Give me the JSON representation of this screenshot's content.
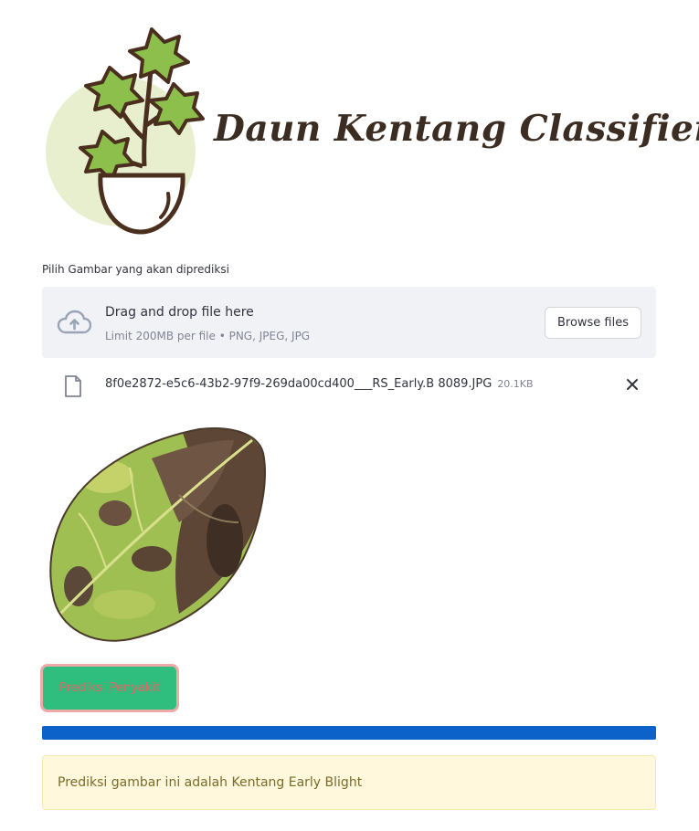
{
  "header": {
    "title": "Daun Kentang Classifier",
    "logo_icon": "plant-pot-icon"
  },
  "uploader": {
    "label": "Pilih Gambar yang akan diprediksi",
    "drop_title": "Drag and drop file here",
    "limit_text": "Limit 200MB per file • PNG, JPEG, JPG",
    "browse_label": "Browse files",
    "upload_icon": "cloud-upload-icon"
  },
  "file": {
    "name": "8f0e2872-e5c6-43b2-97f9-269da00cd400___RS_Early.B 8089.JPG",
    "size": "20.1KB",
    "icon": "file-icon",
    "remove_icon": "close-icon"
  },
  "preview": {
    "subject": "potato-leaf-image"
  },
  "actions": {
    "predict_label": "Prediksi Penyakit"
  },
  "progress": {
    "percent": 100
  },
  "result": {
    "message": "Prediksi gambar ini adalah Kentang Early Blight"
  },
  "colors": {
    "accent_button": "#2fbe7e",
    "button_border": "#f0a9a9",
    "progress": "#0c62c8",
    "result_bg": "#fff8dc",
    "title": "#3b2d22"
  }
}
